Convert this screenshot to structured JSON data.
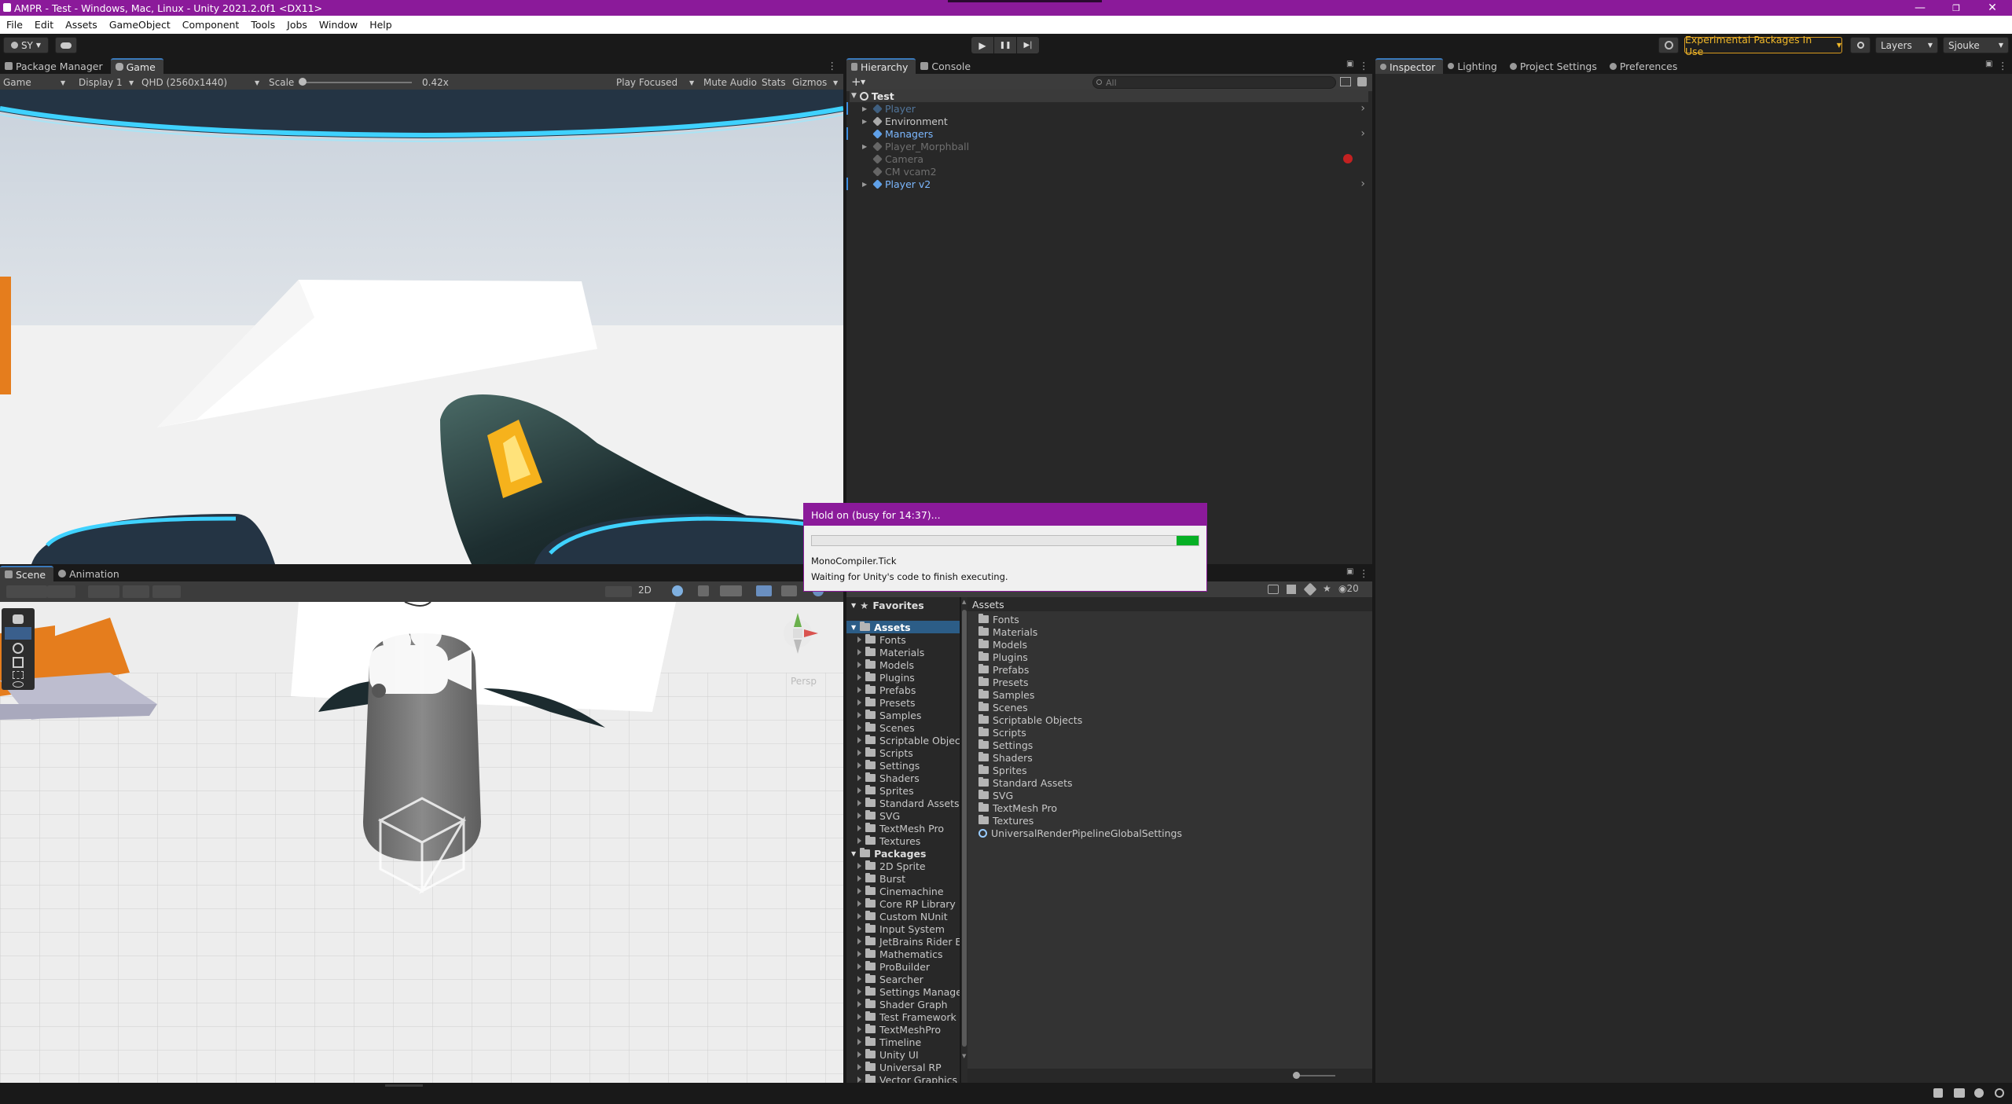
{
  "titlebar": {
    "title": "AMPR - Test - Windows, Mac, Linux - Unity 2021.2.0f1 <DX11>",
    "minimize": "—",
    "restore": "❐",
    "close": "✕"
  },
  "menu": [
    "File",
    "Edit",
    "Assets",
    "GameObject",
    "Component",
    "Tools",
    "Jobs",
    "Window",
    "Help"
  ],
  "toolbar": {
    "account": "SY",
    "experimental": "Experimental Packages In Use",
    "layers": "Layers",
    "layout": "Sjouke",
    "play": "▶",
    "pause": "❚❚",
    "step": "▶|"
  },
  "game_panel": {
    "tabs": [
      "Package Manager",
      "Game"
    ],
    "active_tab": "Game",
    "display_mode": "Game",
    "display": "Display 1",
    "resolution": "QHD (2560x1440)",
    "scale_label": "Scale",
    "scale_value": "0.42x",
    "scale_fraction": 0.0,
    "play_mode": "Play Focused",
    "mute": "Mute Audio",
    "stats": "Stats",
    "gizmos": "Gizmos"
  },
  "scene_panel": {
    "tabs": [
      "Scene",
      "Animation"
    ],
    "active_tab": "Scene",
    "mode2d": "2D",
    "persp": "Persp"
  },
  "hierarchy": {
    "tabs": [
      "Hierarchy",
      "Console"
    ],
    "active_tab": "Hierarchy",
    "search_placeholder": "All",
    "root": "Test",
    "items": [
      {
        "label": "Player",
        "style": "disabled-prefab"
      },
      {
        "label": "Environment",
        "style": "normal"
      },
      {
        "label": "Managers",
        "style": "prefab"
      },
      {
        "label": "Player_Morphball",
        "style": "disabled"
      },
      {
        "label": "Camera",
        "style": "disabled"
      },
      {
        "label": "CM vcam2",
        "style": "disabled"
      },
      {
        "label": "Player v2",
        "style": "prefab"
      }
    ]
  },
  "inspector": {
    "tabs": [
      "Inspector",
      "Lighting",
      "Project Settings",
      "Preferences"
    ],
    "active_tab": "Inspector"
  },
  "project": {
    "favorites": "Favorites",
    "assets_root": "Assets",
    "asset_folders": [
      "Fonts",
      "Materials",
      "Models",
      "Plugins",
      "Prefabs",
      "Presets",
      "Samples",
      "Scenes",
      "Scriptable Objec",
      "Scripts",
      "Settings",
      "Shaders",
      "Sprites",
      "Standard Assets",
      "SVG",
      "TextMesh Pro",
      "Textures"
    ],
    "packages_root": "Packages",
    "package_folders": [
      "2D Sprite",
      "Burst",
      "Cinemachine",
      "Core RP Library",
      "Custom NUnit",
      "Input System",
      "JetBrains Rider E",
      "Mathematics",
      "ProBuilder",
      "Searcher",
      "Settings Manage",
      "Shader Graph",
      "Test Framework",
      "TextMeshPro",
      "Timeline",
      "Unity UI",
      "Universal RP",
      "Vector Graphics"
    ],
    "breadcrumb": "Assets",
    "grid_items": [
      "Fonts",
      "Materials",
      "Models",
      "Plugins",
      "Prefabs",
      "Presets",
      "Samples",
      "Scenes",
      "Scriptable Objects",
      "Scripts",
      "Settings",
      "Shaders",
      "Sprites",
      "Standard Assets",
      "SVG",
      "TextMesh Pro",
      "Textures"
    ],
    "grid_asset": "UniversalRenderPipelineGlobalSettings",
    "hidden_count": "20"
  },
  "dialog": {
    "title": "Hold on (busy for 14:37)...",
    "task": "MonoCompiler.Tick",
    "message": "Waiting for Unity's code to finish executing.",
    "progress": 0.96
  }
}
